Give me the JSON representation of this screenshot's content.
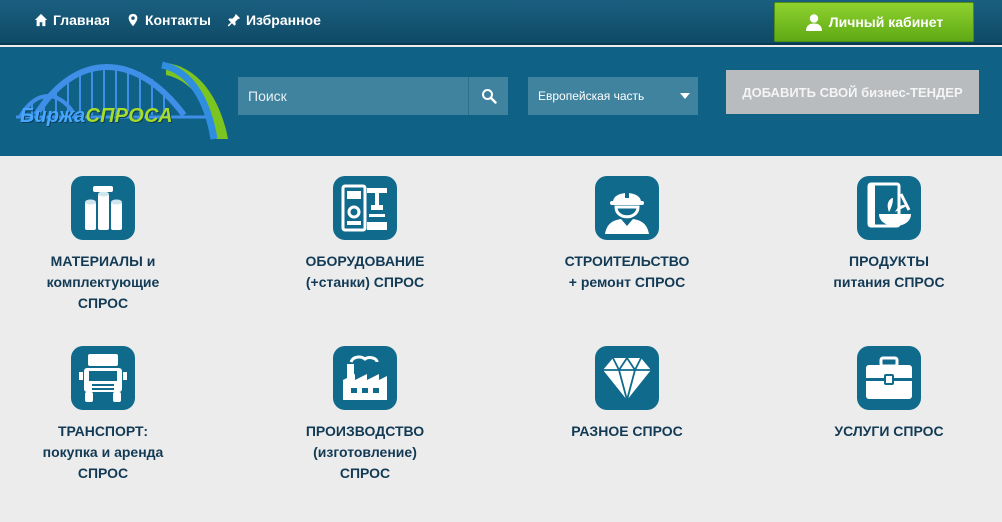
{
  "topnav": {
    "home": "Главная",
    "contacts": "Контакты",
    "favorites": "Избранное"
  },
  "cabinet_label": "Личный кабинет",
  "logo": {
    "part1": "Биржа",
    "part2": "СПРОСА"
  },
  "search": {
    "placeholder": "Поиск",
    "value": ""
  },
  "region": {
    "selected": "Европейская часть"
  },
  "add_tender_label": "ДОБАВИТЬ СВОЙ бизнес-ТЕНДЕР",
  "categories": [
    {
      "lines": [
        "МАТЕРИАЛЫ и",
        "комплектующие",
        "СПРОС"
      ],
      "icon": "materials-icon"
    },
    {
      "lines": [
        "ОБОРУДОВАНИЕ",
        "(+станки) СПРОС"
      ],
      "icon": "equipment-icon"
    },
    {
      "lines": [
        "СТРОИТЕЛЬСТВО",
        "+ ремонт СПРОС"
      ],
      "icon": "worker-icon"
    },
    {
      "lines": [
        "ПРОДУКТЫ",
        "питания СПРОС"
      ],
      "icon": "food-icon"
    },
    {
      "lines": [
        "ТРАНСПОРТ:",
        "покупка и аренда",
        "СПРОС"
      ],
      "icon": "truck-icon"
    },
    {
      "lines": [
        "ПРОИЗВОДСТВО",
        "(изготовление)",
        "СПРОС"
      ],
      "icon": "factory-icon"
    },
    {
      "lines": [
        "РАЗНОЕ СПРОС"
      ],
      "icon": "diamond-icon"
    },
    {
      "lines": [
        "УСЛУГИ СПРОС"
      ],
      "icon": "briefcase-icon"
    }
  ],
  "colors": {
    "header": "#0f6186",
    "accent_green": "#6fbe1e",
    "icon_tile": "#0f6a8c",
    "label_text": "#123a55"
  }
}
